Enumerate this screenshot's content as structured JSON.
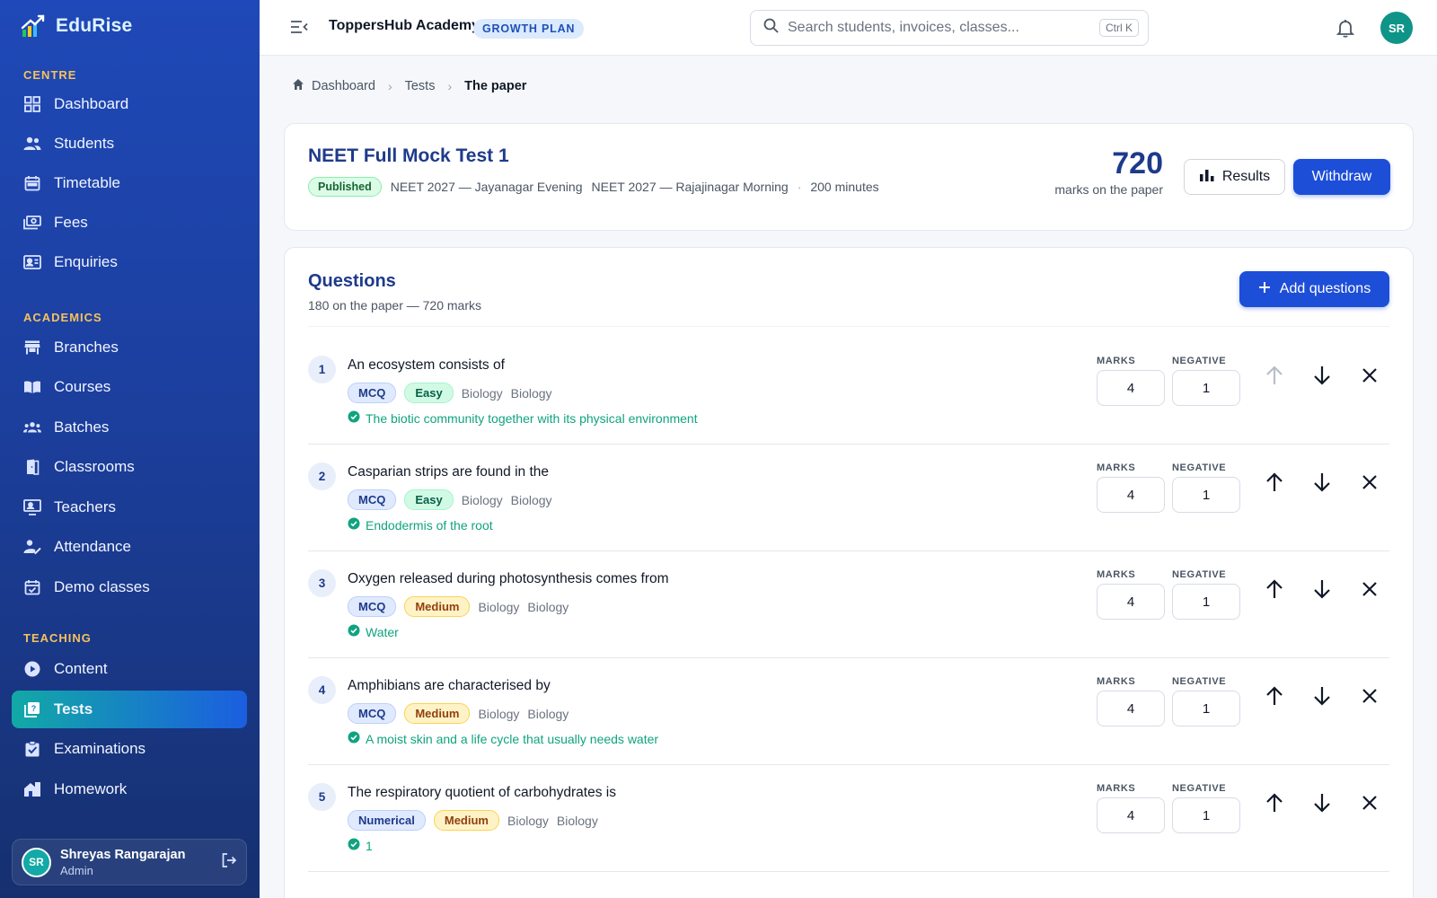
{
  "brand": {
    "name": "EduRise"
  },
  "sidebar": {
    "sections": [
      {
        "label": "CENTRE",
        "items": [
          {
            "label": "Dashboard",
            "icon": "grid-icon"
          },
          {
            "label": "Students",
            "icon": "users-icon"
          },
          {
            "label": "Timetable",
            "icon": "calendar-icon"
          },
          {
            "label": "Fees",
            "icon": "payments-icon"
          },
          {
            "label": "Enquiries",
            "icon": "contact-card-icon"
          }
        ]
      },
      {
        "label": "ACADEMICS",
        "items": [
          {
            "label": "Branches",
            "icon": "store-icon"
          },
          {
            "label": "Courses",
            "icon": "book-open-icon"
          },
          {
            "label": "Batches",
            "icon": "groups-icon"
          },
          {
            "label": "Classrooms",
            "icon": "door-icon"
          },
          {
            "label": "Teachers",
            "icon": "teacher-icon"
          },
          {
            "label": "Attendance",
            "icon": "attendance-icon"
          },
          {
            "label": "Demo classes",
            "icon": "event-icon"
          }
        ]
      },
      {
        "label": "TEACHING",
        "items": [
          {
            "label": "Content",
            "icon": "play-circle-icon"
          },
          {
            "label": "Tests",
            "icon": "quiz-icon",
            "active": true
          },
          {
            "label": "Examinations",
            "icon": "clipboard-check-icon"
          },
          {
            "label": "Homework",
            "icon": "home-work-icon"
          }
        ]
      }
    ],
    "user": {
      "initials": "SR",
      "name": "Shreyas Rangarajan",
      "role": "Admin"
    }
  },
  "topbar": {
    "org_name": "ToppersHub Academy",
    "plan": "GROWTH PLAN",
    "search_placeholder": "Search students, invoices, classes...",
    "shortcut": "Ctrl K",
    "avatar_initials": "SR"
  },
  "breadcrumb": {
    "home": "Dashboard",
    "parent": "Tests",
    "current": "The paper"
  },
  "test": {
    "title": "NEET Full Mock Test 1",
    "status": "Published",
    "batch_1": "NEET 2027 — Jayanagar Evening",
    "batch_2": "NEET 2027 — Rajajinagar Morning",
    "duration": "200 minutes",
    "total_marks": "720",
    "marks_caption": "marks on the paper",
    "results_label": "Results",
    "withdraw_label": "Withdraw"
  },
  "questions": {
    "title": "Questions",
    "subtitle": "180 on the paper — 720 marks",
    "add_label": "Add questions",
    "marks_label": "MARKS",
    "negative_label": "NEGATIVE",
    "items": [
      {
        "num": "1",
        "text": "An ecosystem consists of",
        "type": "MCQ",
        "difficulty": "Easy",
        "subject": "Biology",
        "topic": "Biology",
        "answer": "The biotic community together with its physical environment",
        "marks": "4",
        "negative": "1"
      },
      {
        "num": "2",
        "text": "Casparian strips are found in the",
        "type": "MCQ",
        "difficulty": "Easy",
        "subject": "Biology",
        "topic": "Biology",
        "answer": "Endodermis of the root",
        "marks": "4",
        "negative": "1"
      },
      {
        "num": "3",
        "text": "Oxygen released during photosynthesis comes from",
        "type": "MCQ",
        "difficulty": "Medium",
        "subject": "Biology",
        "topic": "Biology",
        "answer": "Water",
        "marks": "4",
        "negative": "1"
      },
      {
        "num": "4",
        "text": "Amphibians are characterised by",
        "type": "MCQ",
        "difficulty": "Medium",
        "subject": "Biology",
        "topic": "Biology",
        "answer": "A moist skin and a life cycle that usually needs water",
        "marks": "4",
        "negative": "1"
      },
      {
        "num": "5",
        "text": "The respiratory quotient of carbohydrates is",
        "type": "Numerical",
        "difficulty": "Medium",
        "subject": "Biology",
        "topic": "Biology",
        "answer": "1",
        "marks": "4",
        "negative": "1"
      }
    ]
  },
  "colors": {
    "primary": "#1d4ed8",
    "accent": "#12a9a6",
    "sidebar": "#1f49b8",
    "success": "#10a37f"
  }
}
